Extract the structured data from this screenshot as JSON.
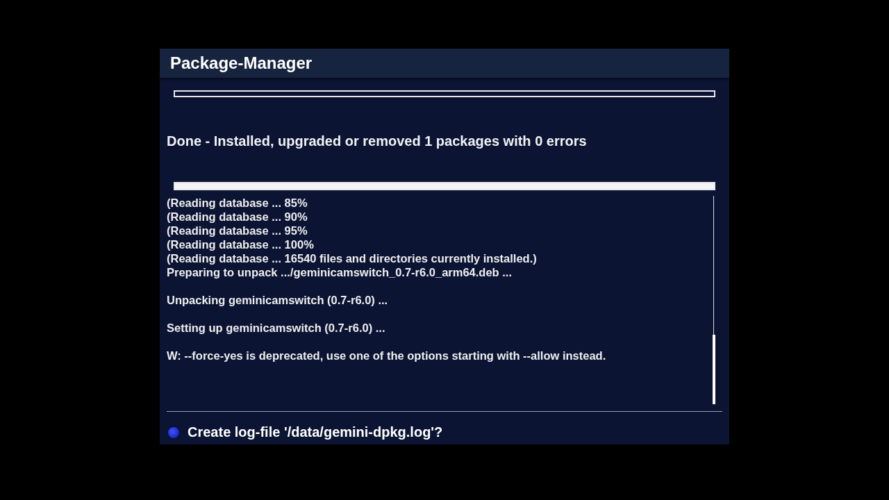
{
  "window": {
    "title": "Package-Manager"
  },
  "top_progress": {
    "level": 0
  },
  "status": "Done - Installed, upgraded or removed 1 packages with 0 errors",
  "log_progress": {
    "level": 1
  },
  "log_blocks": [
    [
      "(Reading database ... 85%",
      "(Reading database ... 90%",
      "(Reading database ... 95%",
      "(Reading database ... 100%",
      "(Reading database ... 16540 files and directories currently installed.)",
      "Preparing to unpack .../geminicamswitch_0.7-r6.0_arm64.deb ..."
    ],
    [
      "Unpacking geminicamswitch (0.7-r6.0) ..."
    ],
    [
      "Setting up geminicamswitch (0.7-r6.0) ..."
    ],
    [
      "W: --force-yes is deprecated, use one of the options starting with --allow instead."
    ]
  ],
  "prompt": {
    "text": "Create log-file '/data/gemini-dpkg.log'?",
    "selected": true
  }
}
